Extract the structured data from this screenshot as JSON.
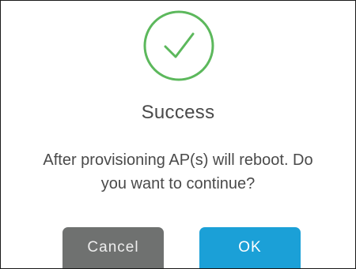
{
  "dialog": {
    "icon": "success-check-icon",
    "title": "Success",
    "message_line1": "After provisioning AP(s) will reboot. Do",
    "message_line2": "you want to continue?",
    "cancel_label": "Cancel",
    "ok_label": "OK"
  },
  "colors": {
    "success_green": "#5cb85c",
    "cancel_gray": "#6f7170",
    "ok_blue": "#1ba0d7",
    "text": "#4a4a4a"
  }
}
